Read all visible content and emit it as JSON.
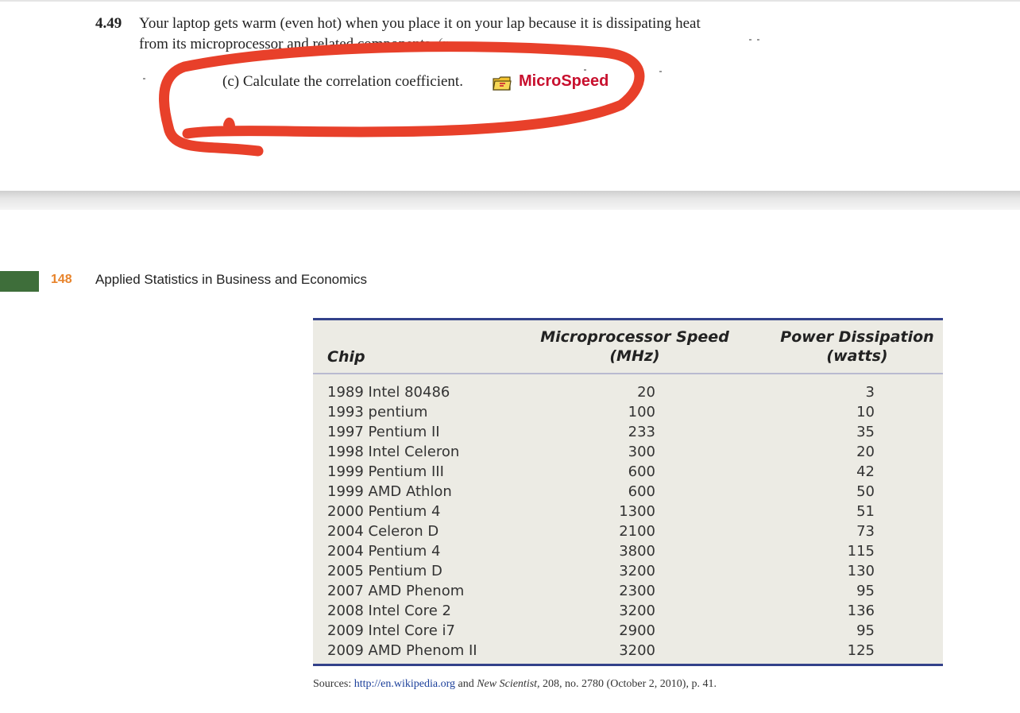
{
  "problem": {
    "number": "4.49",
    "line1": "Your laptop gets warm (even hot) when you place it on your lap because it is dissipating heat",
    "line2": "from its microprocessor and related components.",
    "line2_trail": " (r",
    "part_c": "(c) Calculate the correlation coefficient.",
    "dataset_icon": "data-folder-icon",
    "dataset_name": "MicroSpeed"
  },
  "annotation": {
    "color": "#e8402a"
  },
  "page_header": {
    "page_number": "148",
    "book_title": "Applied Statistics in Business and Economics",
    "bar_color": "#3e6e3a",
    "number_color": "#e8842c"
  },
  "table": {
    "headers": {
      "chip": "Chip",
      "speed_line1": "Microprocessor Speed",
      "speed_line2": "(MHz)",
      "power_line1": "Power Dissipation",
      "power_line2": "(watts)"
    },
    "rows": [
      {
        "chip": "1989 Intel 80486",
        "speed": "20",
        "power": "3"
      },
      {
        "chip": "1993 pentium",
        "speed": "100",
        "power": "10"
      },
      {
        "chip": "1997 Pentium II",
        "speed": "233",
        "power": "35"
      },
      {
        "chip": "1998 Intel Celeron",
        "speed": "300",
        "power": "20"
      },
      {
        "chip": "1999 Pentium III",
        "speed": "600",
        "power": "42"
      },
      {
        "chip": "1999 AMD Athlon",
        "speed": "600",
        "power": "50"
      },
      {
        "chip": "2000 Pentium 4",
        "speed": "1300",
        "power": "51"
      },
      {
        "chip": "2004 Celeron D",
        "speed": "2100",
        "power": "73"
      },
      {
        "chip": "2004 Pentium 4",
        "speed": "3800",
        "power": "115"
      },
      {
        "chip": "2005 Pentium D",
        "speed": "3200",
        "power": "130"
      },
      {
        "chip": "2007 AMD Phenom",
        "speed": "2300",
        "power": "95"
      },
      {
        "chip": "2008 Intel Core 2",
        "speed": "3200",
        "power": "136"
      },
      {
        "chip": "2009 Intel Core i7",
        "speed": "2900",
        "power": "95"
      },
      {
        "chip": "2009 AMD Phenom II",
        "speed": "3200",
        "power": "125"
      }
    ],
    "rule_color": "#33418a",
    "background": "#ecebe4"
  },
  "sources": {
    "prefix": "Sources: ",
    "link": "http://en.wikipedia.org",
    "middle": " and ",
    "journal": "New Scientist,",
    "suffix": " 208, no. 2780 (October 2, 2010), p. 41."
  }
}
